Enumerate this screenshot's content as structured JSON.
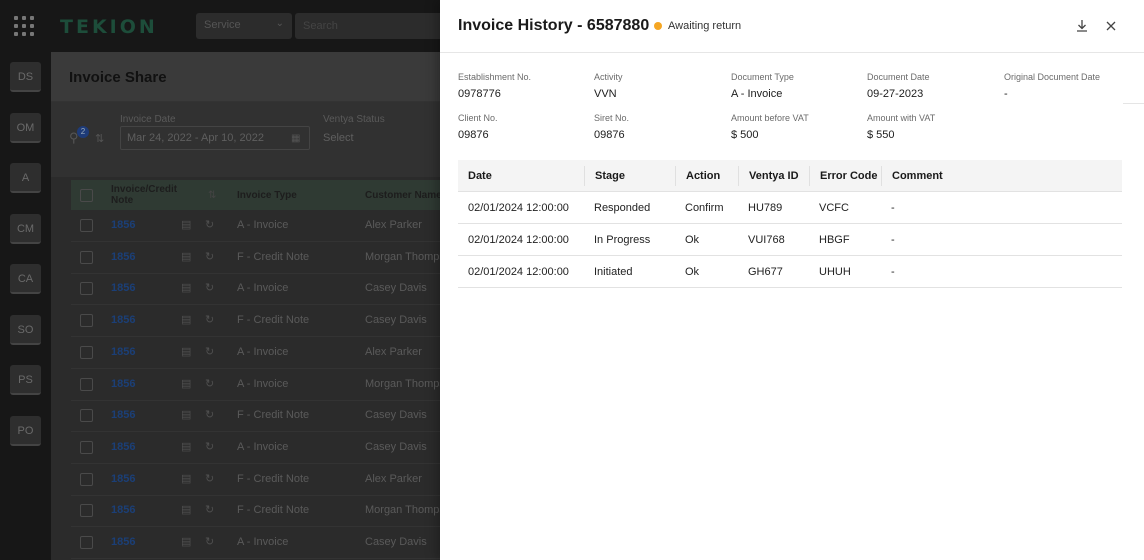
{
  "app": {
    "logo": "TEKION",
    "module": "Service",
    "search_placeholder": "Search",
    "rail": [
      "DS",
      "OM",
      "A",
      "CM",
      "CA",
      "SO",
      "PS",
      "PO"
    ]
  },
  "page": {
    "title": "Invoice Share",
    "filter_count": "2",
    "filters": {
      "invoice_date_label": "Invoice Date",
      "invoice_date_value": "Mar 24, 2022  -  Apr 10, 2022",
      "ventya_status_label": "Ventya Status",
      "ventya_status_value": "Select"
    },
    "columns": [
      "Invoice/Credit Note",
      "Invoice Type",
      "Customer Name"
    ],
    "rows": [
      {
        "id": "1856",
        "type": "A - Invoice",
        "customer": "Alex Parker"
      },
      {
        "id": "1856",
        "type": "F - Credit Note",
        "customer": "Morgan Thompson"
      },
      {
        "id": "1856",
        "type": "A - Invoice",
        "customer": "Casey Davis"
      },
      {
        "id": "1856",
        "type": "F - Credit Note",
        "customer": "Casey Davis"
      },
      {
        "id": "1856",
        "type": "A - Invoice",
        "customer": "Alex Parker"
      },
      {
        "id": "1856",
        "type": "A - Invoice",
        "customer": "Morgan Thompson"
      },
      {
        "id": "1856",
        "type": "F - Credit Note",
        "customer": "Casey Davis"
      },
      {
        "id": "1856",
        "type": "A - Invoice",
        "customer": "Casey Davis"
      },
      {
        "id": "1856",
        "type": "F - Credit Note",
        "customer": "Alex Parker"
      },
      {
        "id": "1856",
        "type": "F - Credit Note",
        "customer": "Morgan Thompson"
      },
      {
        "id": "1856",
        "type": "A - Invoice",
        "customer": "Casey Davis"
      }
    ]
  },
  "drawer": {
    "title": "Invoice History - 6587880",
    "status": "Awaiting return",
    "status_color": "#f5a623",
    "meta": {
      "establishment_no_label": "Establishment No.",
      "establishment_no": "0978776",
      "activity_label": "Activity",
      "activity": "VVN",
      "document_type_label": "Document Type",
      "document_type": "A - Invoice",
      "document_date_label": "Document Date",
      "document_date": "09-27-2023",
      "original_document_date_label": "Original Document Date",
      "original_document_date": "-",
      "client_no_label": "Client No.",
      "client_no": "09876",
      "siret_no_label": "Siret No.",
      "siret_no": "09876",
      "amount_before_vat_label": "Amount before VAT",
      "amount_before_vat": "$ 500",
      "amount_with_vat_label": "Amount with VAT",
      "amount_with_vat": "$ 550"
    },
    "history_columns": [
      "Date",
      "Stage",
      "Action",
      "Ventya ID",
      "Error Code",
      "Comment"
    ],
    "history": [
      {
        "date": "02/01/2024 12:00:00",
        "stage": "Responded",
        "action": "Confirm",
        "ventya_id": "HU789",
        "error_code": "VCFC",
        "comment": "-"
      },
      {
        "date": "02/01/2024 12:00:00",
        "stage": "In Progress",
        "action": "Ok",
        "ventya_id": "VUI768",
        "error_code": "HBGF",
        "comment": "-"
      },
      {
        "date": "02/01/2024 12:00:00",
        "stage": "Initiated",
        "action": "Ok",
        "ventya_id": "GH677",
        "error_code": "UHUH",
        "comment": "-"
      }
    ]
  }
}
